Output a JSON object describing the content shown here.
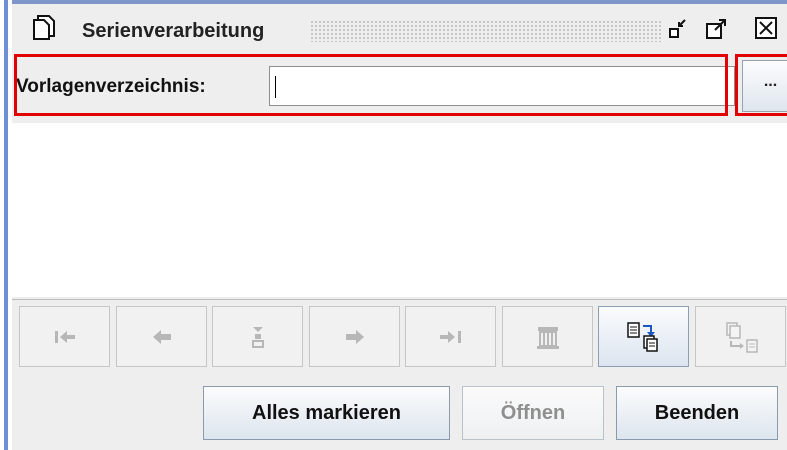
{
  "window": {
    "title": "Serienverarbeitung",
    "icons": [
      "documents-icon",
      "minimize-icon",
      "maximize-icon",
      "close-icon"
    ]
  },
  "form": {
    "label": "Vorlagenverzeichnis:",
    "directory_value": "",
    "browse_label": "..."
  },
  "navigation": {
    "buttons": [
      {
        "name": "first-icon",
        "enabled": false
      },
      {
        "name": "previous-icon",
        "enabled": false
      },
      {
        "name": "tree-icon",
        "enabled": false
      },
      {
        "name": "next-icon",
        "enabled": false
      },
      {
        "name": "last-icon",
        "enabled": false
      },
      {
        "name": "delete-icon",
        "enabled": false
      },
      {
        "name": "import-documents-icon",
        "enabled": true
      },
      {
        "name": "export-documents-icon",
        "enabled": false
      }
    ]
  },
  "actions": {
    "select_all": "Alles markieren",
    "open": "Öffnen",
    "close": "Beenden"
  },
  "colors": {
    "highlight": "#e30000",
    "window_border": "#6d8fd3",
    "panel": "#eeeeee"
  }
}
